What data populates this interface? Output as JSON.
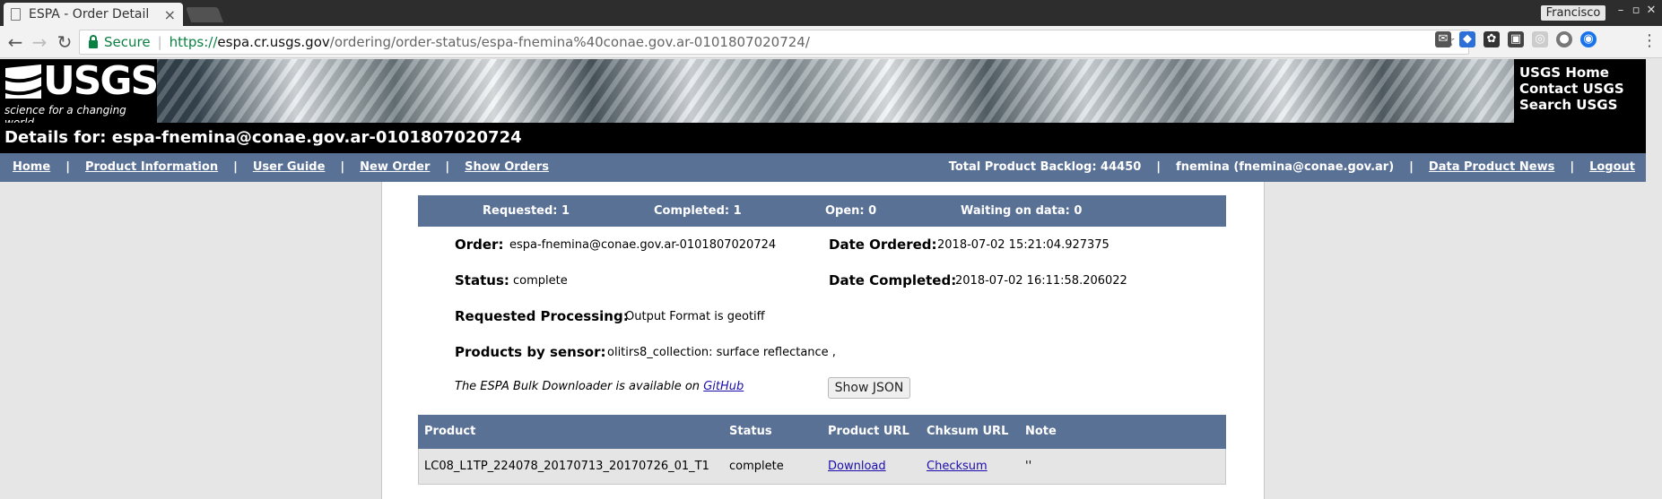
{
  "browser": {
    "tab_title": "ESPA - Order Detail",
    "user": "Francisco",
    "secure_label": "Secure",
    "url_scheme": "https://",
    "url_host": "espa.cr.usgs.gov",
    "url_path": "/ordering/order-status/espa-fnemina%40conae.gov.ar-0101807020724/"
  },
  "header": {
    "logo_text": "USGS",
    "tagline": "science for a changing world",
    "links": [
      "USGS Home",
      "Contact USGS",
      "Search USGS"
    ],
    "details_title": "Details for: espa-fnemina@conae.gov.ar-0101807020724"
  },
  "nav": {
    "left": [
      "Home",
      "Product Information",
      "User Guide",
      "New Order",
      "Show Orders"
    ],
    "backlog": "Total Product Backlog: 44450",
    "user": "fnemina (fnemina@conae.gov.ar)",
    "news": "Data Product News",
    "logout": "Logout"
  },
  "stats": {
    "requested": "Requested: 1",
    "completed": "Completed: 1",
    "open": "Open: 0",
    "waiting": "Waiting on data: 0"
  },
  "order": {
    "order_label": "Order:",
    "order_value": "espa-fnemina@conae.gov.ar-0101807020724",
    "date_ordered_label": "Date Ordered:",
    "date_ordered_value": "2018-07-02 15:21:04.927375",
    "status_label": "Status:",
    "status_value": "complete",
    "date_completed_label": "Date Completed:",
    "date_completed_value": "2018-07-02 16:11:58.206022",
    "processing_label": "Requested Processing:",
    "processing_value": "Output Format is geotiff",
    "sensor_label": "Products by sensor:",
    "sensor_value": "olitirs8_collection: surface reflectance ,",
    "bulk_note_prefix": "The ESPA Bulk Downloader is available on",
    "bulk_note_link": "GitHub",
    "json_button": "Show JSON"
  },
  "products": {
    "headers": [
      "Product",
      "Status",
      "Product URL",
      "Chksum URL",
      "Note"
    ],
    "rows": [
      {
        "product": "LC08_L1TP_224078_20170713_20170726_01_T1",
        "status": "complete",
        "product_url": "Download",
        "chksum_url": "Checksum",
        "note": "''"
      }
    ]
  }
}
